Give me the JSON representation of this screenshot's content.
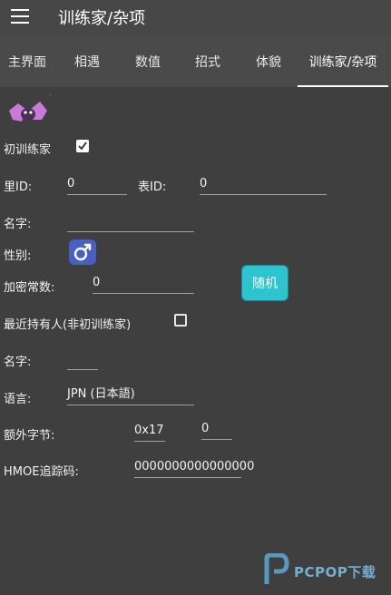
{
  "app": {
    "title": "训练家/杂项"
  },
  "tabs": [
    {
      "label": "主界面"
    },
    {
      "label": "相遇"
    },
    {
      "label": "数值"
    },
    {
      "label": "招式"
    },
    {
      "label": "体貌"
    },
    {
      "label": "训练家/杂项"
    }
  ],
  "active_tab": "训练家/杂项",
  "form": {
    "original_trainer_label": "初训练家",
    "original_trainer_checked": true,
    "sid_label": "里ID:",
    "sid_value": "0",
    "tid_label": "表ID:",
    "tid_value": "0",
    "ot_name_label": "名字:",
    "ot_name_value": "",
    "gender_label": "性别:",
    "gender_icon": "male-symbol-icon",
    "encryption_label": "加密常数:",
    "encryption_value": "0",
    "random_button_label": "随机",
    "handler_label": "最近持有人(非初训练家)",
    "handler_checked": false,
    "handler_name_label": "名字:",
    "handler_name_value": "",
    "language_label": "语言:",
    "language_value": "JPN (日本語)",
    "extra_bytes_label": "额外字节:",
    "extra_bytes_offset": "0x17",
    "extra_bytes_value": "0",
    "hmoe_label": "HMOE追踪码:",
    "hmoe_value": "0000000000000000"
  },
  "watermark": {
    "text": "PCPOP下载"
  },
  "colors": {
    "accent": "#2ec4cf",
    "gender_male": "#4a5fc2"
  }
}
